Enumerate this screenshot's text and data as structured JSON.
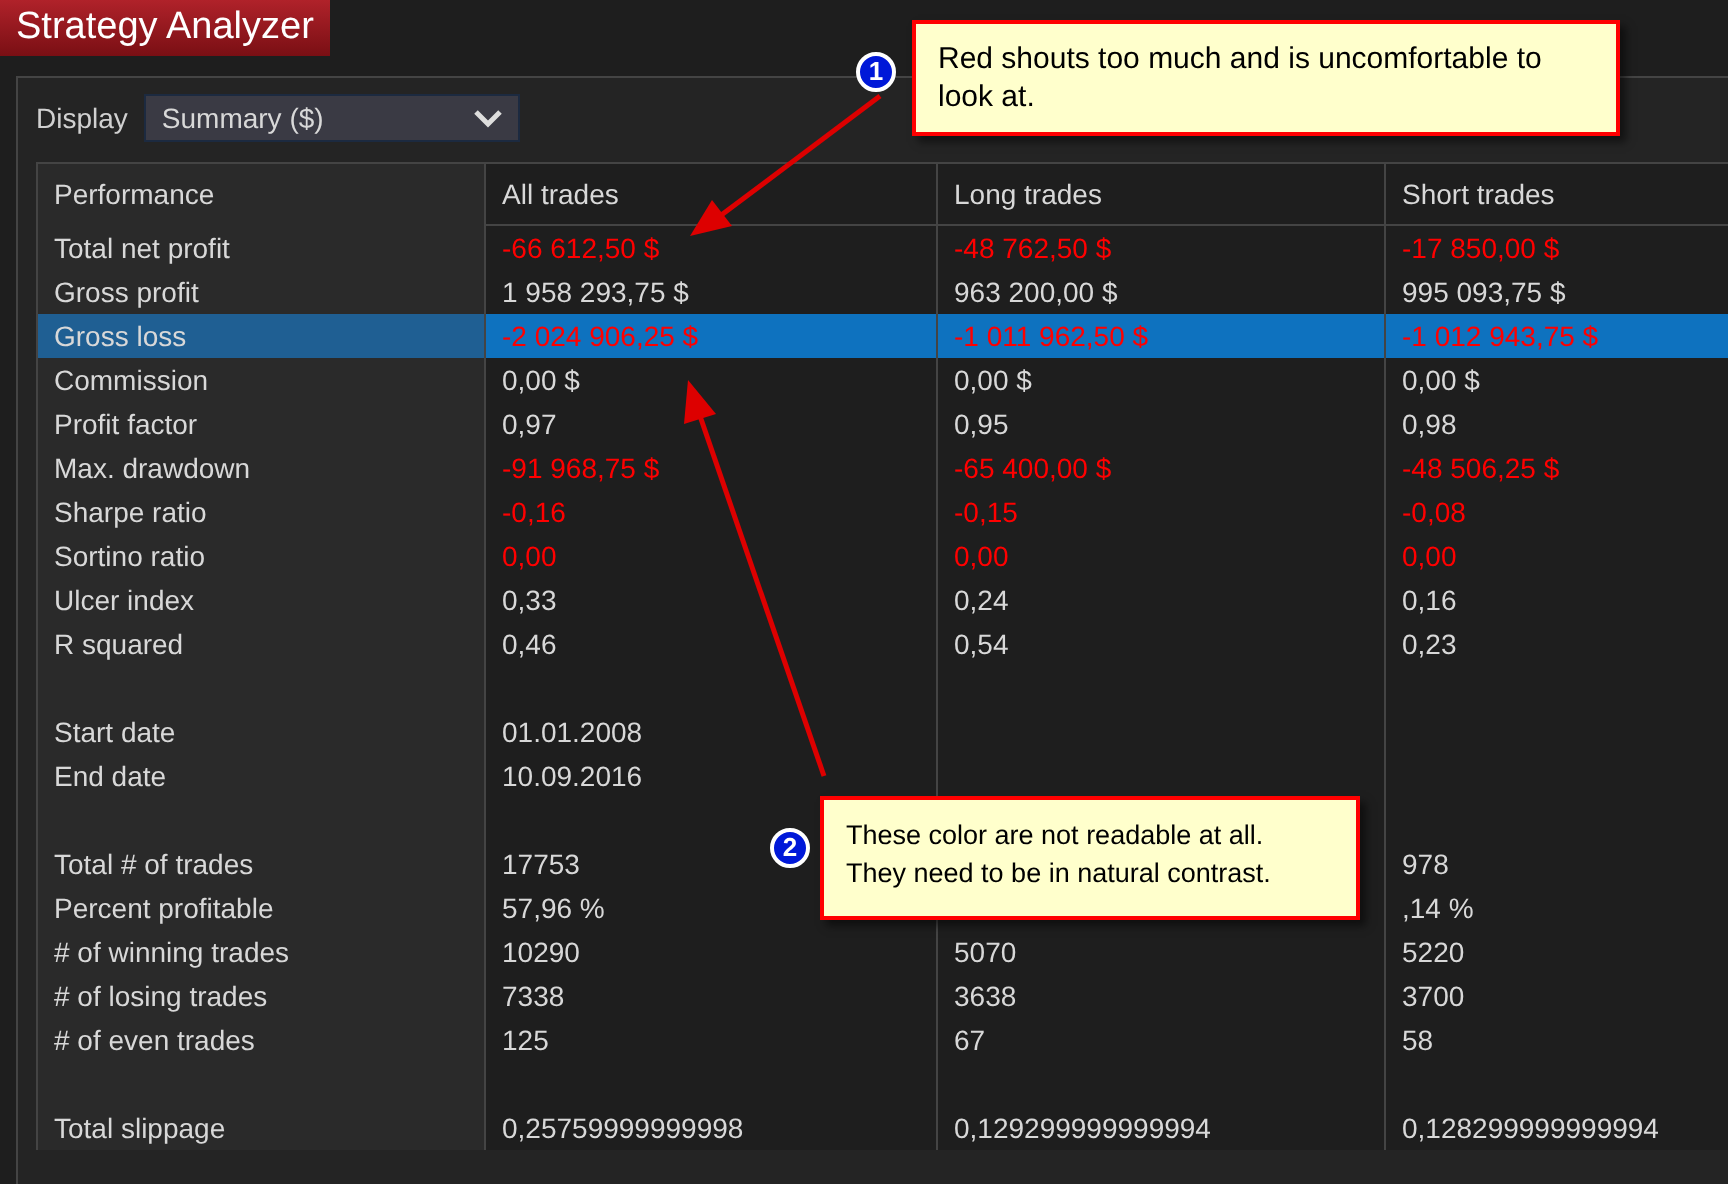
{
  "window": {
    "title": "Strategy Analyzer"
  },
  "display": {
    "label": "Display",
    "value": "Summary ($)"
  },
  "table": {
    "columns": [
      "Performance",
      "All trades",
      "Long trades",
      "Short trades"
    ],
    "rows": [
      {
        "kind": "metric",
        "label": "Total net profit",
        "selected": false,
        "cells": [
          {
            "text": "-66 612,50 $",
            "negative": true
          },
          {
            "text": "-48 762,50 $",
            "negative": true
          },
          {
            "text": "-17 850,00 $",
            "negative": true
          }
        ]
      },
      {
        "kind": "metric",
        "label": "Gross profit",
        "selected": false,
        "cells": [
          {
            "text": "1 958 293,75 $",
            "negative": false
          },
          {
            "text": "963 200,00 $",
            "negative": false
          },
          {
            "text": "995 093,75 $",
            "negative": false
          }
        ]
      },
      {
        "kind": "metric",
        "label": "Gross loss",
        "selected": true,
        "cells": [
          {
            "text": "-2 024 906,25 $",
            "negative": true
          },
          {
            "text": "-1 011 962,50 $",
            "negative": true
          },
          {
            "text": "-1 012 943,75 $",
            "negative": true
          }
        ]
      },
      {
        "kind": "metric",
        "label": "Commission",
        "selected": false,
        "cells": [
          {
            "text": "0,00 $",
            "negative": false
          },
          {
            "text": "0,00 $",
            "negative": false
          },
          {
            "text": "0,00 $",
            "negative": false
          }
        ]
      },
      {
        "kind": "metric",
        "label": "Profit factor",
        "selected": false,
        "cells": [
          {
            "text": "0,97",
            "negative": false
          },
          {
            "text": "0,95",
            "negative": false
          },
          {
            "text": "0,98",
            "negative": false
          }
        ]
      },
      {
        "kind": "metric",
        "label": "Max. drawdown",
        "selected": false,
        "cells": [
          {
            "text": "-91 968,75 $",
            "negative": true
          },
          {
            "text": "-65 400,00 $",
            "negative": true
          },
          {
            "text": "-48 506,25 $",
            "negative": true
          }
        ]
      },
      {
        "kind": "metric",
        "label": "Sharpe ratio",
        "selected": false,
        "cells": [
          {
            "text": "-0,16",
            "negative": true
          },
          {
            "text": "-0,15",
            "negative": true
          },
          {
            "text": "-0,08",
            "negative": true
          }
        ]
      },
      {
        "kind": "metric",
        "label": "Sortino ratio",
        "selected": false,
        "cells": [
          {
            "text": "0,00",
            "negative": true
          },
          {
            "text": "0,00",
            "negative": true
          },
          {
            "text": "0,00",
            "negative": true
          }
        ]
      },
      {
        "kind": "metric",
        "label": "Ulcer index",
        "selected": false,
        "cells": [
          {
            "text": "0,33",
            "negative": false
          },
          {
            "text": "0,24",
            "negative": false
          },
          {
            "text": "0,16",
            "negative": false
          }
        ]
      },
      {
        "kind": "metric",
        "label": "R squared",
        "selected": false,
        "cells": [
          {
            "text": "0,46",
            "negative": false
          },
          {
            "text": "0,54",
            "negative": false
          },
          {
            "text": "0,23",
            "negative": false
          }
        ]
      },
      {
        "kind": "spacer"
      },
      {
        "kind": "metric",
        "label": "Start date",
        "selected": false,
        "cells": [
          {
            "text": "01.01.2008",
            "negative": false
          },
          null,
          null
        ]
      },
      {
        "kind": "metric",
        "label": "End date",
        "selected": false,
        "cells": [
          {
            "text": "10.09.2016",
            "negative": false
          },
          null,
          null
        ]
      },
      {
        "kind": "spacer"
      },
      {
        "kind": "metric",
        "label": "Total # of trades",
        "selected": false,
        "cells": [
          {
            "text": "17753",
            "negative": false
          },
          null,
          {
            "text": "978",
            "negative": false
          }
        ]
      },
      {
        "kind": "metric",
        "label": "Percent profitable",
        "selected": false,
        "cells": [
          {
            "text": "57,96 %",
            "negative": false
          },
          null,
          {
            "text": ",14 %",
            "negative": false
          }
        ]
      },
      {
        "kind": "metric",
        "label": "# of winning trades",
        "selected": false,
        "cells": [
          {
            "text": "10290",
            "negative": false
          },
          {
            "text": "5070",
            "negative": false
          },
          {
            "text": "5220",
            "negative": false
          }
        ]
      },
      {
        "kind": "metric",
        "label": "# of losing trades",
        "selected": false,
        "cells": [
          {
            "text": "7338",
            "negative": false
          },
          {
            "text": "3638",
            "negative": false
          },
          {
            "text": "3700",
            "negative": false
          }
        ]
      },
      {
        "kind": "metric",
        "label": "# of even trades",
        "selected": false,
        "cells": [
          {
            "text": "125",
            "negative": false
          },
          {
            "text": "67",
            "negative": false
          },
          {
            "text": "58",
            "negative": false
          }
        ]
      },
      {
        "kind": "spacer"
      },
      {
        "kind": "metric",
        "label": "Total slippage",
        "selected": false,
        "cells": [
          {
            "text": "0,25759999999998",
            "negative": false
          },
          {
            "text": "0,129299999999994",
            "negative": false
          },
          {
            "text": "0,128299999999994",
            "negative": false
          }
        ]
      }
    ]
  },
  "annotations": [
    {
      "number": "1",
      "text": "Red shouts too much and is uncomfortable to look at."
    },
    {
      "number": "2",
      "text": "These color are not readable at all. They need to be in natural contrast."
    }
  ]
}
